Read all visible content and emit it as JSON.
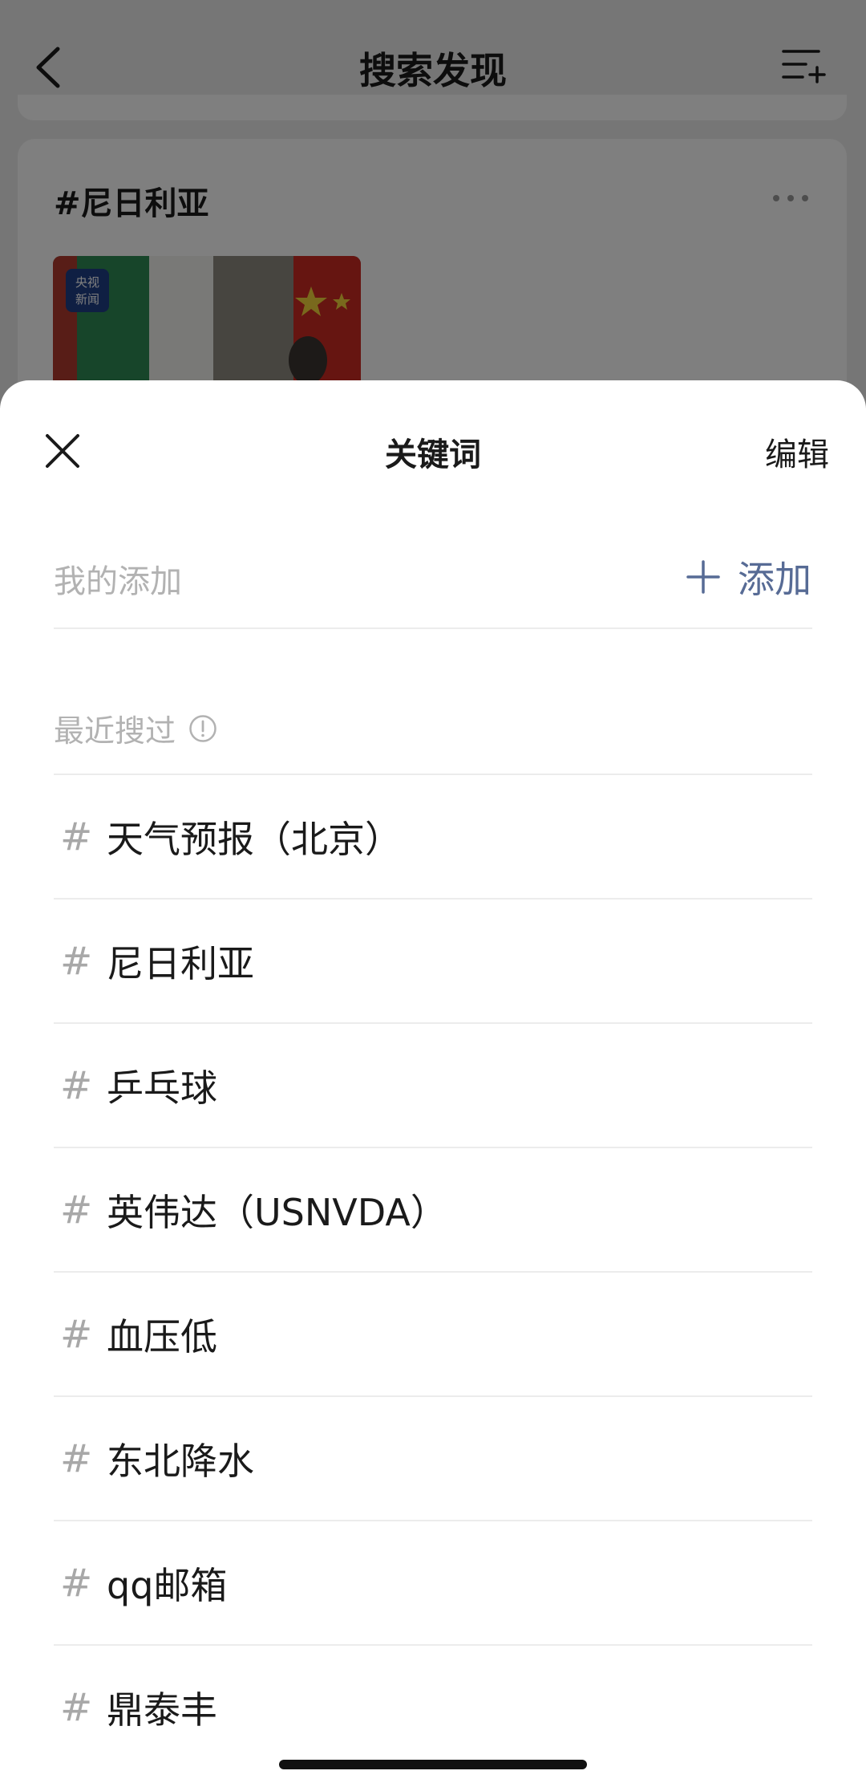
{
  "background": {
    "title": "搜索发现",
    "card_title": "#尼日利亚",
    "thumb_badge": [
      "央视",
      "新闻"
    ]
  },
  "sheet": {
    "title": "关键词",
    "edit_label": "编辑",
    "my_added_label": "我的添加",
    "add_label": "添加",
    "recent_label": "最近搜过",
    "keywords": [
      "天气预报（北京）",
      "尼日利亚",
      "乒乓球",
      "英伟达（USNVDA）",
      "血压低",
      "东北降水",
      "qq邮箱",
      "鼎泰丰"
    ]
  },
  "icons": {
    "back": "chevron-left-icon",
    "list_add": "list-add-icon",
    "more": "more-dots-icon",
    "close": "close-icon",
    "plus": "plus-icon",
    "info": "info-circle-icon",
    "hash": "hashtag-icon"
  },
  "colors": {
    "accent": "#576b95",
    "muted_text": "#b2b2b2",
    "primary_text": "#1a1a1a",
    "overlay": "rgba(0,0,0,0.5)"
  }
}
